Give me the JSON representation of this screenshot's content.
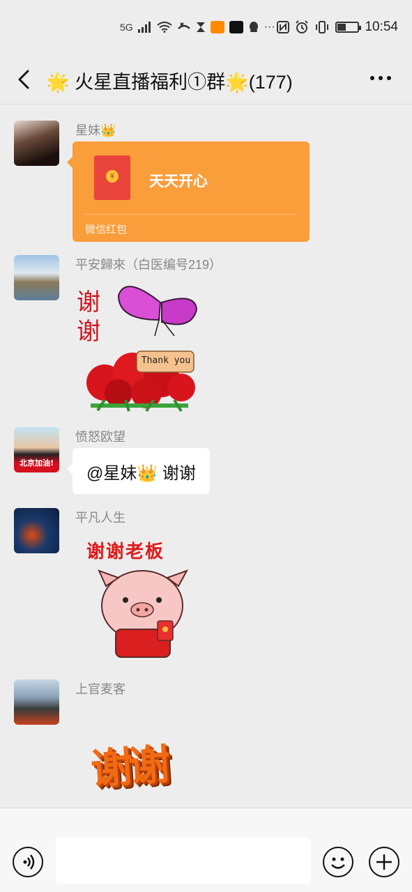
{
  "status_bar": {
    "network": "5G",
    "time": "10:54"
  },
  "header": {
    "title": "🌟 火星直播福利①群🌟(177)"
  },
  "messages": [
    {
      "sender": "星妹👑",
      "type": "red_packet",
      "red_packet": {
        "text": "天天开心",
        "footer": "微信红包",
        "coin": "¥"
      }
    },
    {
      "sender": "平安歸來（白医编号219）",
      "type": "sticker",
      "sticker": {
        "text_vertical_1": "谢",
        "text_vertical_2": "谢",
        "tag": "Thank you"
      }
    },
    {
      "sender": "愤怒欧望",
      "type": "text",
      "text": "@星妹👑  谢谢",
      "avatar_caption": "北京加油!"
    },
    {
      "sender": "平凡人生",
      "type": "sticker",
      "sticker": {
        "caption": "谢谢老板"
      }
    },
    {
      "sender": "上官麦客",
      "type": "sticker",
      "sticker": {
        "caption": "谢谢"
      }
    }
  ],
  "icons": {
    "back": "chevron-left-icon",
    "more": "more-horizontal-icon",
    "voice": "voice-input-icon",
    "emoji": "emoji-icon",
    "plus": "plus-icon"
  },
  "colors": {
    "background": "#ededed",
    "red_packet": "#fa9d3b",
    "red_packet_icon": "#e9443b",
    "bubble": "#ffffff"
  }
}
